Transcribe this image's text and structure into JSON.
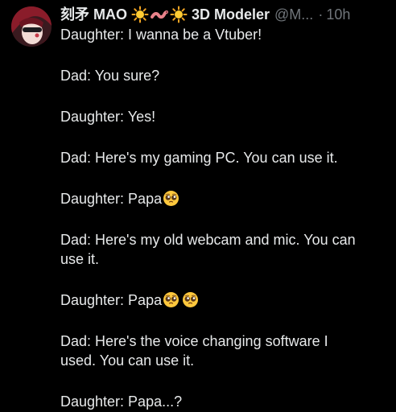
{
  "author": {
    "name_prefix": "刻矛 MAO",
    "name_suffix": "3D Modeler",
    "handle": "@M...",
    "separator": "·",
    "time": "10h",
    "name_icons": [
      "sun-icon",
      "worm-icon",
      "sun-icon"
    ]
  },
  "tweet": {
    "lines": [
      "Daughter: I wanna be a Vtuber!",
      "Dad: You sure?",
      "Daughter: Yes!",
      "Dad: Here's my gaming PC. You can use it.",
      "Daughter: Papa",
      "Dad: Here's my old webcam and mic. You can",
      "use it.",
      "Daughter: Papa",
      "Dad: Here's the voice changing software I",
      "used. You can use it.",
      "Daughter: Papa...?"
    ],
    "emojis": [
      "pleading-face-icon"
    ]
  },
  "colors": {
    "background": "#000000",
    "text": "#e7e9ea",
    "muted": "#71767b"
  }
}
